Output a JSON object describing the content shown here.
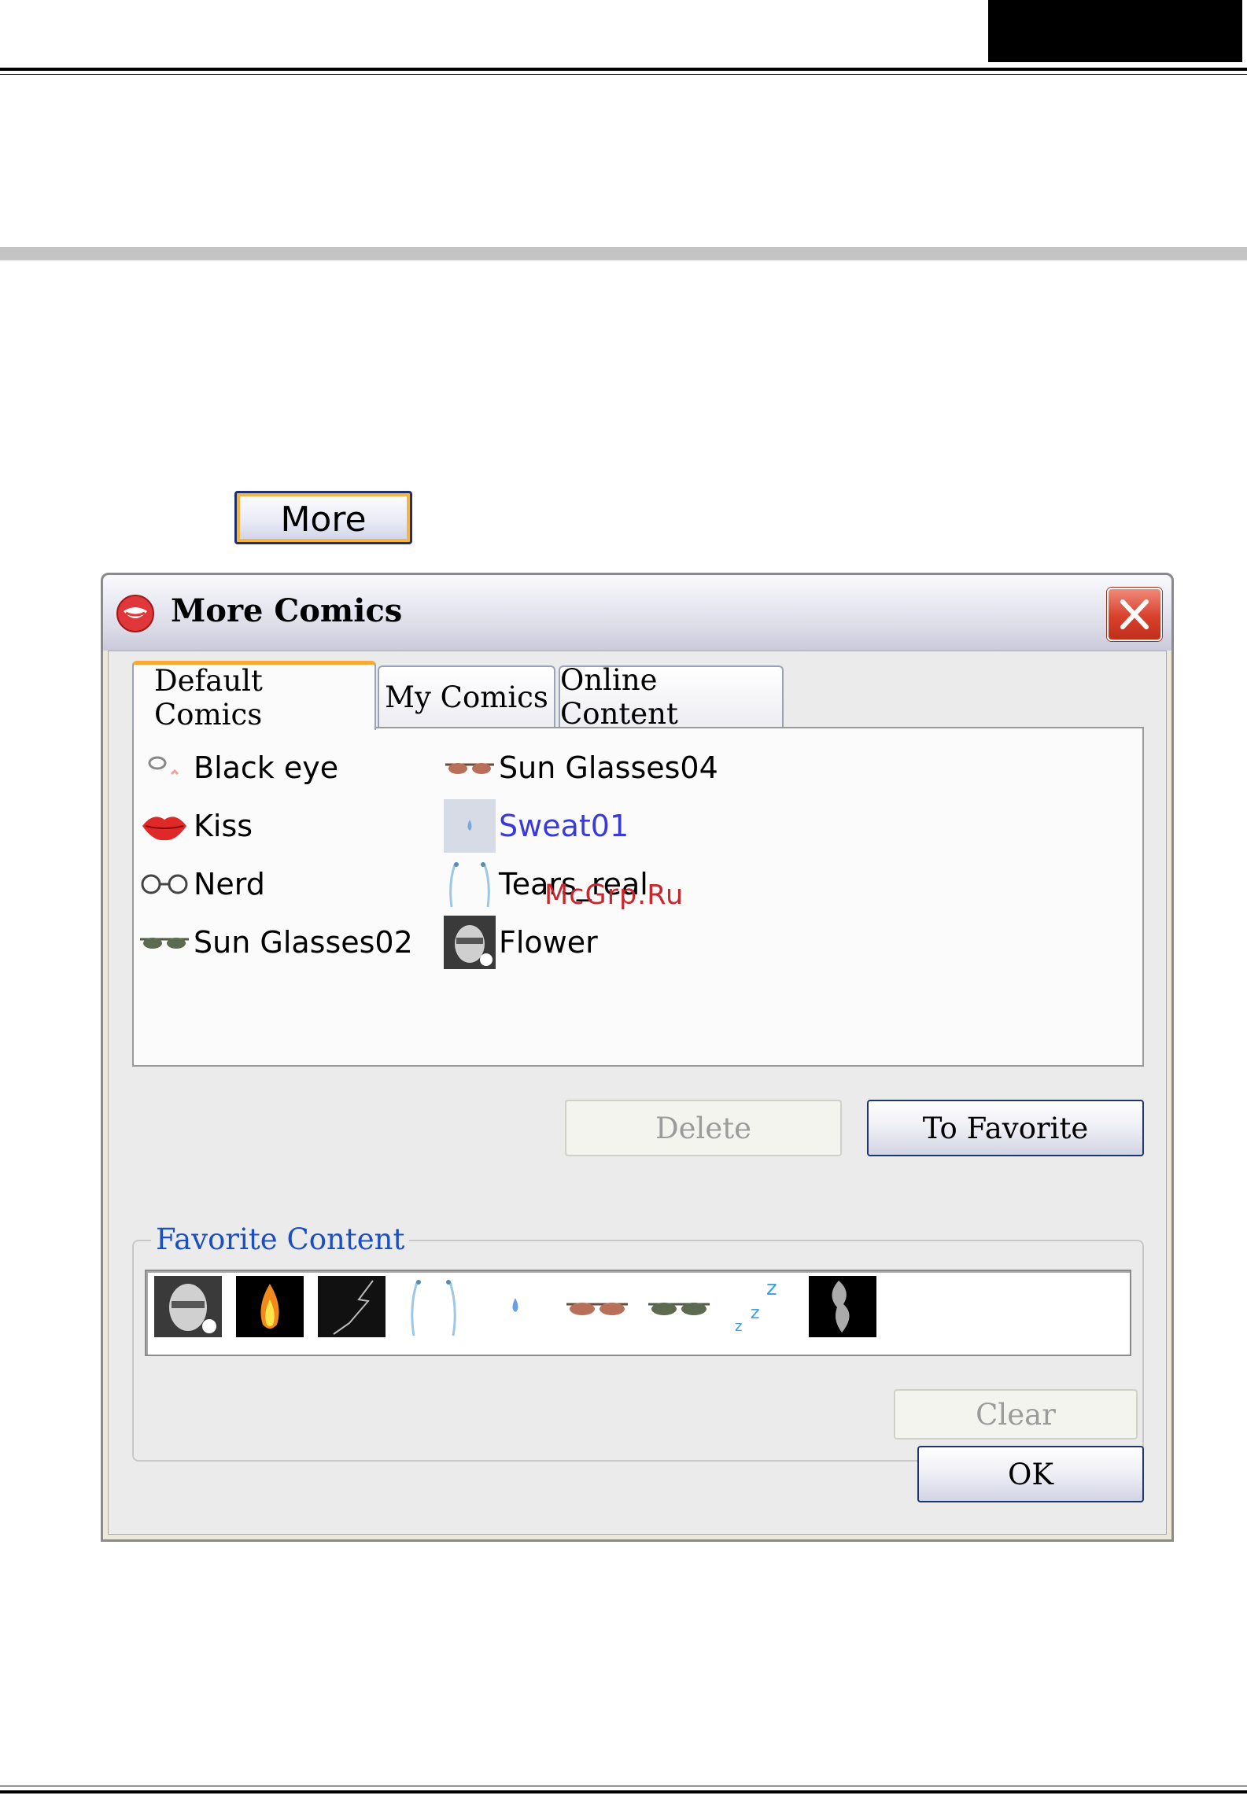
{
  "page": {
    "more_button_label": "More"
  },
  "dialog": {
    "title": "More Comics",
    "tabs": [
      {
        "label": "Default Comics",
        "active": true
      },
      {
        "label": "My Comics",
        "active": false
      },
      {
        "label": "Online Content",
        "active": false
      }
    ],
    "comics": {
      "column1": [
        {
          "label": "Black eye",
          "icon": "black-eye-icon"
        },
        {
          "label": "Kiss",
          "icon": "lips-icon"
        },
        {
          "label": "Nerd",
          "icon": "nerd-glasses-icon"
        },
        {
          "label": "Sun Glasses02",
          "icon": "sunglasses-icon"
        }
      ],
      "column2": [
        {
          "label": "Sun Glasses04",
          "icon": "sunglasses-icon"
        },
        {
          "label": "Sweat01",
          "icon": "sweat-drop-icon",
          "link_color": "#3a3ad8"
        },
        {
          "label": "Tears_real",
          "icon": "tears-icon"
        },
        {
          "label": "Flower",
          "icon": "face-thumbnail-icon"
        }
      ]
    },
    "buttons": {
      "delete": "Delete",
      "to_favorite": "To Favorite",
      "clear": "Clear",
      "ok": "OK"
    },
    "favorite_content": {
      "legend": "Favorite Content",
      "items": [
        "face-thumbnail-icon",
        "fire-icon",
        "lightning-icon",
        "tears-icon",
        "sweat-drop-icon",
        "sunglasses-red-icon",
        "sunglasses-green-icon",
        "sleep-zzz-icon",
        "smoke-icon"
      ]
    }
  },
  "watermark": "McGrp.Ru",
  "colors": {
    "tab_accent": "#f7a835",
    "legend_text": "#1a4fc4",
    "disabled_text": "#9b9b9b",
    "close_button": "#d8402c"
  }
}
